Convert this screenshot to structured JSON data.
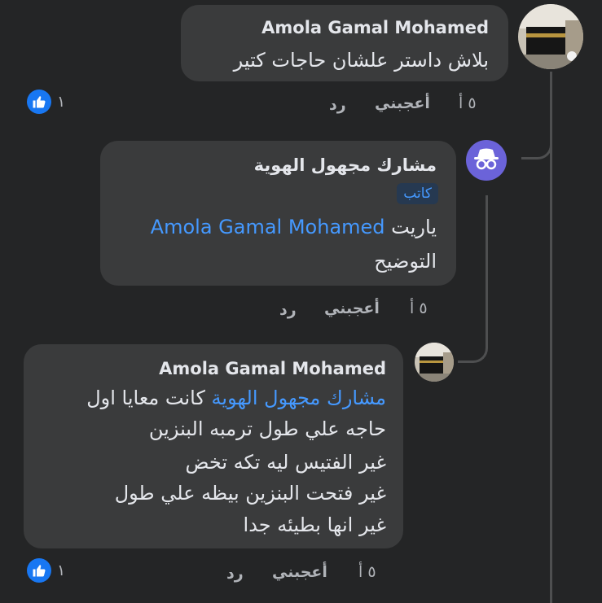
{
  "comments": [
    {
      "author": "Amola Gamal Mohamed",
      "text": "بلاش داستر علشان حاجات كتير",
      "time": "٥ أ",
      "like_label": "أعجبني",
      "reply_label": "رد",
      "reaction_count": "١",
      "reaction_icon": "thumbs-up-icon"
    },
    {
      "author": "مشارك مجهول الهوية",
      "badge": "كاتب",
      "mention": "Amola Gamal Mohamed",
      "text_after_mention": "ياريت",
      "text_line2": "التوضيح",
      "time": "٥ أ",
      "like_label": "أعجبني",
      "reply_label": "رد",
      "avatar_icon": "anonymous-spy-icon"
    },
    {
      "author": "Amola Gamal Mohamed",
      "mention": "مشارك مجهول الهوية",
      "text_after_mention": "كانت معايا اول",
      "lines": [
        "حاجه علي طول ترمبه البنزين",
        "غير الفتيس ليه تكه تخض",
        "غير فتحت البنزين بيظه علي طول",
        "غير انها بطيئه جدا"
      ],
      "time": "٥ أ",
      "like_label": "أعجبني",
      "reply_label": "رد",
      "reaction_count": "١",
      "reaction_icon": "thumbs-up-icon"
    }
  ],
  "colors": {
    "background": "#242526",
    "bubble": "#3a3b3c",
    "mention": "#4599ff",
    "like_blue": "#1877f2"
  }
}
